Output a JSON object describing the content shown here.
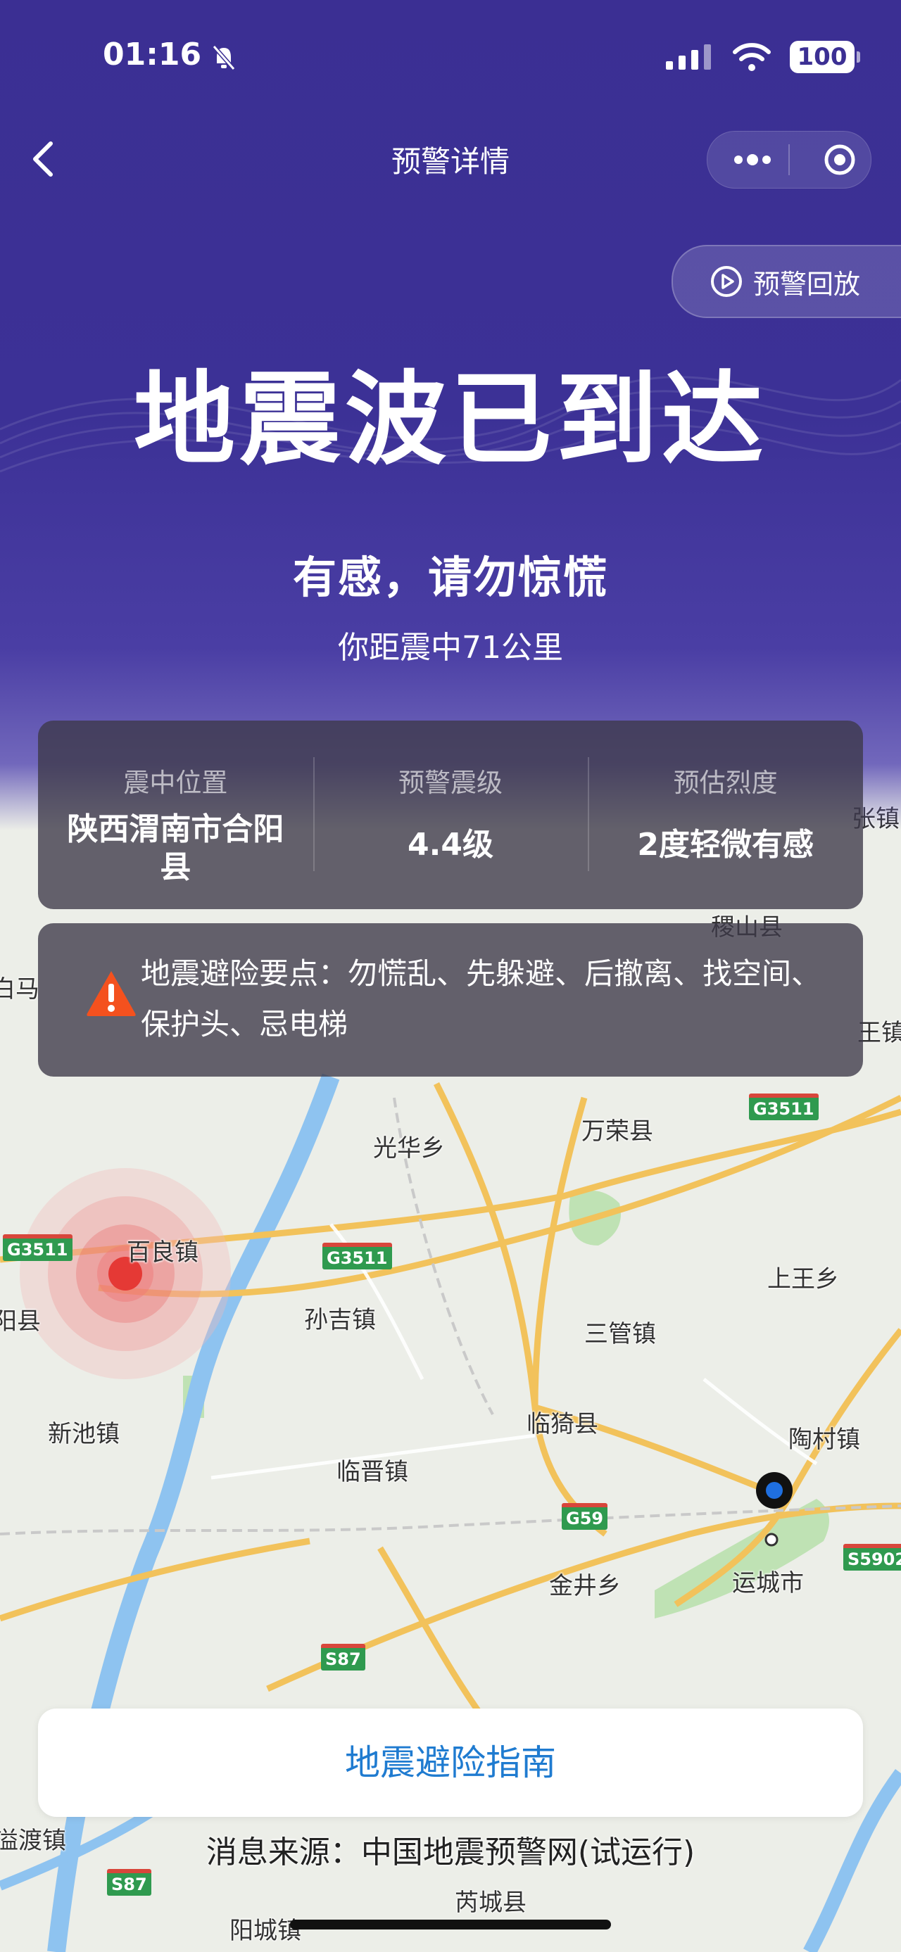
{
  "status_bar": {
    "time": "01:16",
    "battery": "100"
  },
  "nav": {
    "title": "预警详情"
  },
  "replay_button": {
    "label": "预警回放"
  },
  "alert": {
    "headline": "地震波已到达",
    "subheadline": "有感，请勿惊慌",
    "distance": "你距震中71公里"
  },
  "info": {
    "epicenter_label": "震中位置",
    "epicenter_value": "陕西渭南市合阳县",
    "magnitude_label": "预警震级",
    "magnitude_value": "4.4级",
    "intensity_label": "预估烈度",
    "intensity_value": "2度轻微有感"
  },
  "tips": {
    "text": "地震避险要点：勿慌乱、先躲避、后撤离、找空间、保护头、忌电梯"
  },
  "guide_button": {
    "label": "地震避险指南"
  },
  "source": "消息来源：中国地震预警网(试运行)",
  "map": {
    "places": [
      "张镇",
      "稷山县",
      "白马",
      "王镇",
      "光华乡",
      "万荣县",
      "百良镇",
      "阳县",
      "孙吉镇",
      "上王乡",
      "三管镇",
      "新池镇",
      "临猗县",
      "陶村镇",
      "临晋镇",
      "金井乡",
      "运城市",
      "溢渡镇",
      "芮城县",
      "阳城镇"
    ],
    "roads": [
      "G3511",
      "G3511",
      "G3511",
      "G59",
      "S87",
      "S5902",
      "S87"
    ]
  },
  "colors": {
    "header": "#3b2f93",
    "link": "#1f7bd0",
    "epicenter": "#e53935",
    "user_location": "#1f6fe0"
  }
}
